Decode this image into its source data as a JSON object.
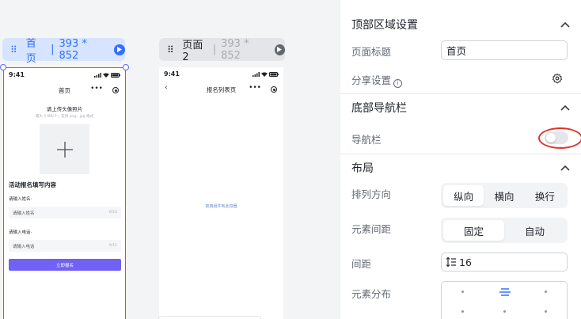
{
  "canvas": {
    "pages": [
      {
        "name": "首页",
        "size": "393 * 852",
        "active": true
      },
      {
        "name": "页面2",
        "size": "393 * 852",
        "active": false
      }
    ],
    "separator": "|"
  },
  "phone1": {
    "time": "9:41",
    "title": "首页",
    "upload_title": "请上传头像照片",
    "upload_hint": "最大 5 MB/个，支持 png、jpg 格式",
    "form_title": "活动报名填写内容",
    "fields": [
      {
        "label": "请输入姓名·",
        "placeholder": "请输入姓名",
        "count": "0/14"
      },
      {
        "label": "请输入电话·",
        "placeholder": "请输入电话",
        "count": "0/11"
      }
    ],
    "submit_label": "立即报名"
  },
  "phone2": {
    "time": "9:41",
    "title": "报名列表页",
    "drop_hint": "拖拽组件到此容器"
  },
  "panel": {
    "top_section": {
      "title": "顶部区域设置",
      "page_title_label": "页面标题",
      "page_title_value": "首页",
      "share_label": "分享设置"
    },
    "bottom_nav": {
      "title": "底部导航栏",
      "nav_label": "导航栏",
      "nav_enabled": false
    },
    "layout": {
      "title": "布局",
      "direction_label": "排列方向",
      "direction_options": [
        "纵向",
        "横向",
        "换行"
      ],
      "direction_selected": "纵向",
      "spacing_label": "元素间距",
      "spacing_options": [
        "固定",
        "自动"
      ],
      "spacing_selected": "固定",
      "gap_label": "间距",
      "gap_value": "16",
      "distribution_label": "元素分布"
    }
  },
  "colors": {
    "accent": "#3370ff",
    "submit": "#7161f4",
    "highlight_ring": "#e0352b"
  }
}
